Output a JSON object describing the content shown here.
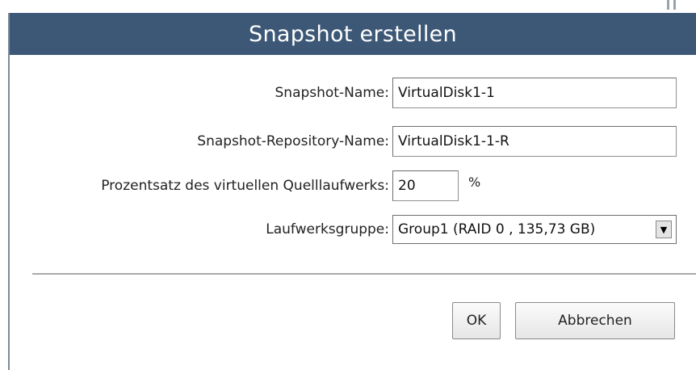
{
  "dialog": {
    "title": "Snapshot erstellen"
  },
  "form": {
    "snapshot_name": {
      "label": "Snapshot-Name:",
      "value": "VirtualDisk1-1"
    },
    "repository_name": {
      "label": "Snapshot-Repository-Name:",
      "value": "VirtualDisk1-1-R"
    },
    "percentage": {
      "label": "Prozentsatz des virtuellen Quelllaufwerks:",
      "value": "20",
      "unit": "%"
    },
    "disk_group": {
      "label": "Laufwerksgruppe:",
      "selected": "Group1 (RAID 0 , 135,73 GB)",
      "arrow": "▼"
    }
  },
  "buttons": {
    "ok": "OK",
    "cancel": "Abbrechen"
  },
  "colors": {
    "titlebar": "#3d5876",
    "title_text": "#ffffff"
  }
}
